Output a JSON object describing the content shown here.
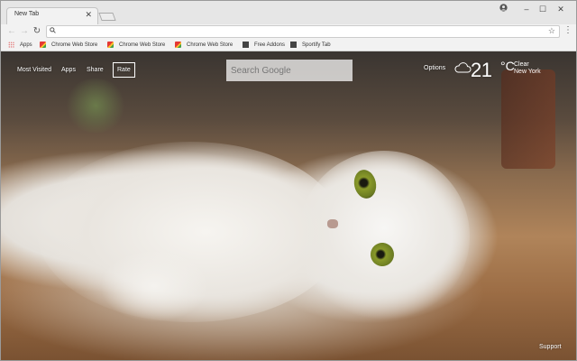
{
  "browser": {
    "tab_title": "New Tab",
    "tab_close": "✕",
    "address_value": "",
    "controls": {
      "minimize": "–",
      "maximize": "☐",
      "close": "✕"
    }
  },
  "bookmarks": [
    {
      "label": "Apps",
      "icon": "apps-grid-icon"
    },
    {
      "label": "Chrome Web Store",
      "icon": "webstore-icon"
    },
    {
      "label": "Chrome Web Store",
      "icon": "webstore-icon"
    },
    {
      "label": "Chrome Web Store",
      "icon": "webstore-icon"
    },
    {
      "label": "Free Addons",
      "icon": "addons-icon"
    },
    {
      "label": "Sportify Tab",
      "icon": "sportify-icon"
    }
  ],
  "newtab": {
    "nav": {
      "most_visited": "Most Visited",
      "apps": "Apps",
      "share": "Share",
      "rate": "Rate"
    },
    "search_placeholder": "Search Google",
    "options": "Options",
    "weather": {
      "temperature": "21",
      "unit": "°C",
      "condition": "Clear",
      "city": "New York",
      "icon": "cloud-icon"
    },
    "support": "Support"
  }
}
